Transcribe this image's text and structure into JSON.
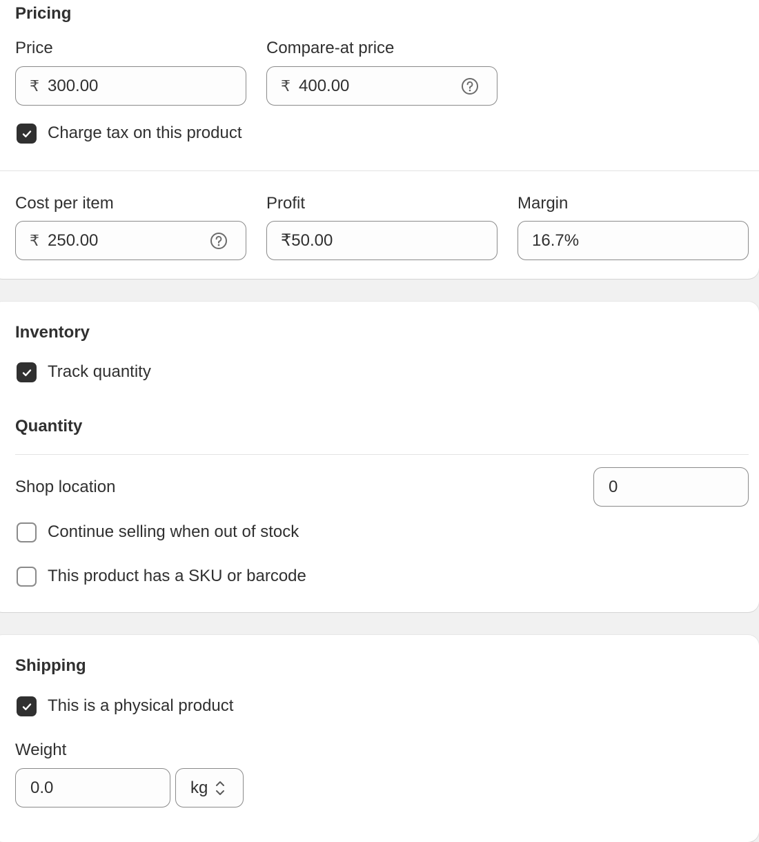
{
  "pricing": {
    "title": "Pricing",
    "price_label": "Price",
    "price_currency": "₹",
    "price_value": "300.00",
    "compare_label": "Compare-at price",
    "compare_currency": "₹",
    "compare_value": "400.00",
    "charge_tax_label": "Charge tax on this product",
    "charge_tax_checked": true,
    "cost_label": "Cost per item",
    "cost_currency": "₹",
    "cost_value": "250.00",
    "profit_label": "Profit",
    "profit_value": "₹50.00",
    "margin_label": "Margin",
    "margin_value": "16.7%"
  },
  "inventory": {
    "title": "Inventory",
    "track_label": "Track quantity",
    "track_checked": true,
    "quantity_title": "Quantity",
    "location_label": "Shop location",
    "location_qty": "0",
    "continue_selling_label": "Continue selling when out of stock",
    "continue_selling_checked": false,
    "sku_label": "This product has a SKU or barcode",
    "sku_checked": false
  },
  "shipping": {
    "title": "Shipping",
    "physical_label": "This is a physical product",
    "physical_checked": true,
    "weight_label": "Weight",
    "weight_value": "0.0",
    "weight_unit": "kg"
  },
  "icons": {
    "help": "help-circle-icon",
    "check": "checkmark-icon",
    "select": "chevron-up-down-icon"
  },
  "colors": {
    "checkbox_fill": "#303030",
    "input_border": "#8a8a8a",
    "background": "#f1f1f1",
    "card": "#ffffff"
  }
}
